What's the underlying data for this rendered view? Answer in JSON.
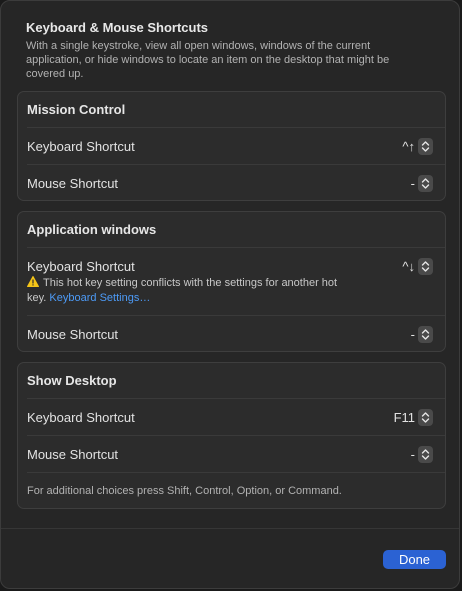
{
  "dialog": {
    "title": "Keyboard & Mouse Shortcuts",
    "description": "With a single keystroke, view all open windows, windows of the current application, or hide windows to locate an item on the desktop that might be covered up."
  },
  "groups": [
    {
      "title": "Mission Control",
      "rows": [
        {
          "label": "Keyboard Shortcut",
          "value": "^↑"
        },
        {
          "label": "Mouse Shortcut",
          "value": "-"
        }
      ]
    },
    {
      "title": "Application windows",
      "rows": [
        {
          "label": "Keyboard Shortcut",
          "value": "^↓"
        },
        {
          "label": "Mouse Shortcut",
          "value": "-"
        }
      ],
      "warning": {
        "text_line1": "This hot key setting conflicts with the settings for another hot",
        "text_line2": "key.",
        "link": "Keyboard Settings…"
      }
    },
    {
      "title": "Show Desktop",
      "rows": [
        {
          "label": "Keyboard Shortcut",
          "value": "F11"
        },
        {
          "label": "Mouse Shortcut",
          "value": "-"
        }
      ],
      "footnote": "For additional choices press Shift, Control, Option, or Command."
    }
  ],
  "footer": {
    "done_label": "Done"
  },
  "colors": {
    "accent": "#2b62d3",
    "link": "#4d9bf7",
    "warning": "#f5c518"
  }
}
